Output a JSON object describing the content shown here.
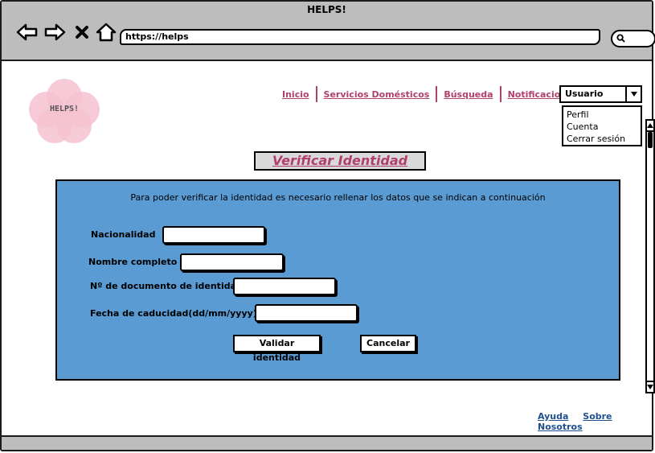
{
  "window": {
    "title": "HELPS!"
  },
  "browser": {
    "url": "https://helps"
  },
  "logo": {
    "name": "HELPS!"
  },
  "nav": {
    "items": [
      "Inicio",
      "Servicios Domésticos",
      "Búsqueda",
      "Notificaciones"
    ]
  },
  "user_menu": {
    "selected": "Usuario",
    "options": [
      "Perfil",
      "Cuenta",
      "Cerrar sesión"
    ]
  },
  "page": {
    "heading": "Verificar Identidad"
  },
  "form": {
    "intro": "Para poder verificar la identidad es necesario rellenar los datos que se indican a continuación",
    "fields": [
      {
        "label": "Nacionalidad",
        "value": ""
      },
      {
        "label": "Nombre completo",
        "value": ""
      },
      {
        "label": "Nº de documento de identidad",
        "value": ""
      },
      {
        "label": "Fecha de caducidad(dd/mm/yyyy)",
        "value": ""
      }
    ],
    "validate_label": "Validar identidad",
    "cancel_label": "Cancelar"
  },
  "footer": {
    "help": "Ayuda",
    "about": "Sobre Nosotros"
  },
  "colors": {
    "accent": "#b03f6c",
    "panel": "#5a9bd3",
    "chrome": "#bdbdbd",
    "footer_link": "#1f4f8f",
    "logo_pink": "#f4c2d0"
  }
}
